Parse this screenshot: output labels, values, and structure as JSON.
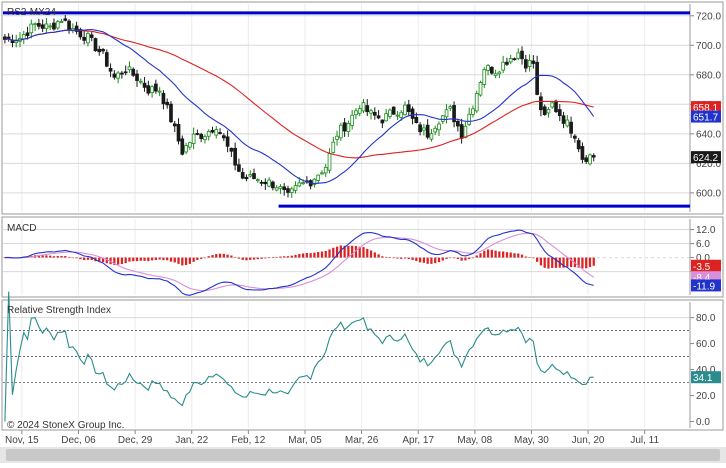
{
  "symbol": "RS2-MX24",
  "copyright": "© 2024 StoneX Group Inc.",
  "colors": {
    "up": "#1a8c1a",
    "down": "#1a1a1a",
    "ma_fast": "#2233cc",
    "ma_slow": "#dd2222",
    "hline": "#0000cc",
    "macd_line": "#2233cc",
    "signal_line": "#d98fd9",
    "hist_pos": "#dd2222",
    "hist_neg": "#dd2222",
    "rsi_line": "#2a8c8c",
    "grid": "#d9d9d9",
    "axis_text": "#444444"
  },
  "x_axis": {
    "labels": [
      "Nov, 15",
      "Dec, 06",
      "Dec, 29",
      "Jan, 22",
      "Feb, 12",
      "Mar, 05",
      "Mar, 26",
      "Apr, 17",
      "May, 08",
      "May, 30",
      "Jun, 20",
      "Jul, 11"
    ],
    "label_bars": [
      5,
      20,
      35,
      50,
      65,
      80,
      95,
      110,
      125,
      140,
      155,
      170
    ],
    "total_bars": 182
  },
  "chart_data": [
    {
      "name": "price",
      "type": "candlestick",
      "title": "RS2-MX24",
      "ylim": [
        587,
        728
      ],
      "yticks": [
        600.0,
        620.0,
        640.0,
        660.0,
        680.0,
        700.0,
        720.0
      ],
      "ytick_labels": [
        "600.0",
        "620.0",
        "640.0",
        "660.0",
        "680.0",
        "700.0",
        "720.0"
      ],
      "horizontal_lines": [
        {
          "value": 722,
          "from_bar": 0,
          "to_bar": 182
        },
        {
          "value": 591,
          "from_bar": 73,
          "to_bar": 182
        }
      ],
      "bars": 157,
      "anchors_close": [
        [
          0,
          704
        ],
        [
          4,
          705
        ],
        [
          8,
          714
        ],
        [
          12,
          712
        ],
        [
          15,
          718
        ],
        [
          18,
          711
        ],
        [
          22,
          705
        ],
        [
          26,
          693
        ],
        [
          29,
          678
        ],
        [
          32,
          684
        ],
        [
          35,
          678
        ],
        [
          38,
          670
        ],
        [
          41,
          670
        ],
        [
          44,
          650
        ],
        [
          47,
          628
        ],
        [
          50,
          638
        ],
        [
          53,
          640
        ],
        [
          56,
          646
        ],
        [
          58,
          636
        ],
        [
          60,
          625
        ],
        [
          63,
          610
        ],
        [
          66,
          610
        ],
        [
          69,
          608
        ],
        [
          72,
          605
        ],
        [
          75,
          597
        ],
        [
          78,
          605
        ],
        [
          81,
          608
        ],
        [
          85,
          618
        ],
        [
          88,
          640
        ],
        [
          91,
          648
        ],
        [
          94,
          660
        ],
        [
          97,
          653
        ],
        [
          100,
          650
        ],
        [
          103,
          655
        ],
        [
          106,
          658
        ],
        [
          109,
          645
        ],
        [
          112,
          640
        ],
        [
          115,
          650
        ],
        [
          118,
          656
        ],
        [
          121,
          640
        ],
        [
          124,
          660
        ],
        [
          127,
          685
        ],
        [
          130,
          683
        ],
        [
          133,
          690
        ],
        [
          136,
          695
        ],
        [
          138,
          688
        ],
        [
          140,
          688
        ],
        [
          141,
          665
        ],
        [
          143,
          650
        ],
        [
          145,
          660
        ],
        [
          148,
          650
        ],
        [
          151,
          640
        ],
        [
          153,
          624
        ],
        [
          155,
          625
        ],
        [
          156,
          624
        ]
      ],
      "ma_fast": {
        "label": "651.7",
        "last": 651.7
      },
      "ma_slow": {
        "label": "658.1",
        "last": 658.1
      },
      "last_label": "624.2",
      "last_value": 624.2
    },
    {
      "name": "macd",
      "type": "macd",
      "title": "MACD",
      "ylim": [
        -16,
        16.5
      ],
      "yticks": [
        -6.0,
        0.0,
        6.0,
        12.0
      ],
      "ytick_labels": [
        "-6.0",
        "0.0",
        "6.0",
        "12.0"
      ],
      "labels": {
        "hist": "-3.5",
        "signal": "-8.4",
        "macd": "-11.9"
      },
      "values": {
        "hist": -3.5,
        "signal": -8.4,
        "macd": -11.9
      }
    },
    {
      "name": "rsi",
      "type": "line",
      "title": "Relative Strength Index",
      "ylim": [
        -5,
        92
      ],
      "yticks": [
        0.0,
        20.0,
        40.0,
        60.0,
        80.0
      ],
      "ytick_labels": [
        "0.0",
        "20.0",
        "40.0",
        "60.0",
        "80.0"
      ],
      "dashed_levels": [
        30,
        50,
        70
      ],
      "last_label": "34.1",
      "last_value": 34.1
    }
  ]
}
